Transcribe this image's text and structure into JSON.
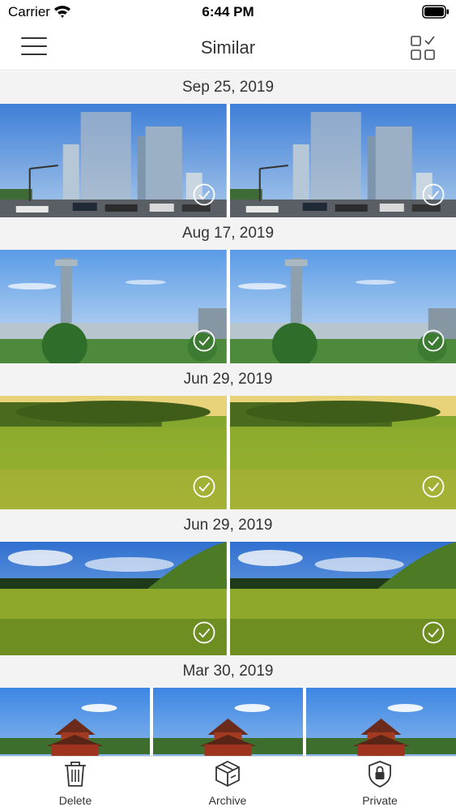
{
  "status_bar": {
    "carrier": "Carrier",
    "time": "6:44 PM",
    "wifi_icon": "wifi-icon",
    "battery_icon": "battery-icon"
  },
  "nav": {
    "title": "Similar",
    "menu_icon": "hamburger-menu-icon",
    "select_icon": "select-grid-icon"
  },
  "groups": [
    {
      "date": "Sep 25, 2019",
      "scene": "city",
      "photos": 2
    },
    {
      "date": "Aug 17, 2019",
      "scene": "tower",
      "photos": 2
    },
    {
      "date": "Jun 29, 2019",
      "scene": "meadow",
      "photos": 2
    },
    {
      "date": "Jun 29, 2019",
      "scene": "grassland",
      "photos": 2
    },
    {
      "date": "Mar 30, 2019",
      "scene": "palace",
      "photos": 3
    }
  ],
  "tabs": [
    {
      "label": "Delete",
      "icon": "trash-icon"
    },
    {
      "label": "Archive",
      "icon": "archive-box-icon"
    },
    {
      "label": "Private",
      "icon": "shield-lock-icon"
    }
  ],
  "colors": {
    "header_bg": "#f3f3f3",
    "text": "#333333",
    "sky": "#4f8fe0"
  }
}
